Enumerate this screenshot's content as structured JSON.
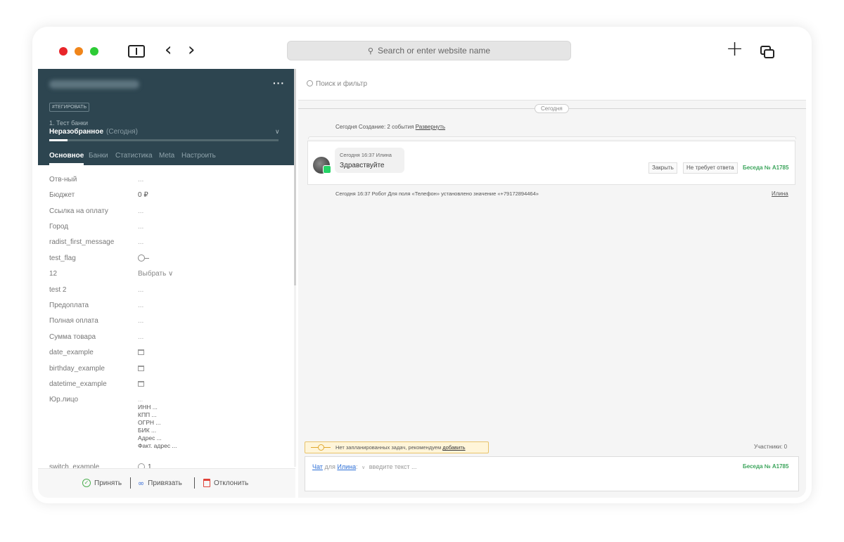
{
  "browser": {
    "address_placeholder": "Search or enter website name",
    "colors": {
      "close": "#e8252a",
      "minimize": "#f0851a",
      "zoom": "#2dcb35"
    }
  },
  "lead": {
    "tag": "#ТЕГИРОВАТЬ",
    "pipeline": "1. Тест банки",
    "stage": "Неразобранное",
    "stage_date": "(Сегодня)",
    "stage_progress": 0.08,
    "more_label": "···",
    "tabs": [
      "Основное",
      "Банки",
      "Статистика",
      "Meta",
      "Настроить"
    ]
  },
  "fields": [
    {
      "label": "Отв-ный",
      "value": "..."
    },
    {
      "label": "Бюджет",
      "value": "0 ₽"
    },
    {
      "label": "Ссылка на оплату",
      "value": "..."
    },
    {
      "label": "Город",
      "value": "..."
    },
    {
      "label": "radist_first_message",
      "value": "..."
    },
    {
      "label": "test_flag",
      "value": ""
    },
    {
      "label": "12",
      "value": "Выбрать ∨"
    },
    {
      "label": "test 2",
      "value": "..."
    },
    {
      "label": "Предоплата",
      "value": "..."
    },
    {
      "label": "Полная оплата",
      "value": "..."
    },
    {
      "label": "Сумма товара",
      "value": "..."
    },
    {
      "label": "date_example",
      "value": ""
    },
    {
      "label": "birthday_example",
      "value": ""
    },
    {
      "label": "datetime_example",
      "value": ""
    },
    {
      "label": "Юр.лицо",
      "value": "...",
      "sub": [
        "ИНН ...",
        "КПП ...",
        "ОГРН ...",
        "БИК ...",
        "Адрес ...",
        "Факт. адрес ..."
      ]
    },
    {
      "label": "switch_example",
      "value": "1"
    }
  ],
  "footer": {
    "accept": "Принять",
    "bind": "Привязать",
    "reject": "Отклонить"
  },
  "feed": {
    "search_placeholder": "Поиск и фильтр",
    "today": "Сегодня",
    "event1": "Сегодня Создание: 2 события",
    "event1_link": "Развернуть",
    "message": {
      "meta": "Сегодня 16:37 Илина",
      "text": "Здравствуйте",
      "close": "Закрыть",
      "no_reply": "Не требует ответа",
      "conversation": "Беседа № A1785"
    },
    "event2": "Сегодня 16:37 Робот Для поля «Телефон» установлено значение «+79172894464»",
    "event2_user": "Илина",
    "task_text": "Нет запланированных задач, рекомендуем",
    "task_link": "добавить",
    "participants": "Участники: 0"
  },
  "compose": {
    "chat": "Чат",
    "for": "для",
    "recipient": "Илина",
    "placeholder": "введите текст ...",
    "conversation": "Беседа № A1785"
  }
}
